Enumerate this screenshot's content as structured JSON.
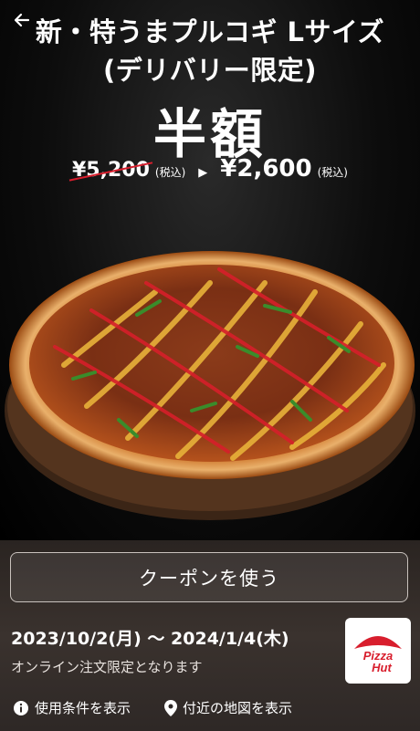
{
  "header": {
    "title_line1": "新・特うまプルコギ Lサイズ",
    "title_line2": "(デリバリー限定)",
    "back_icon": "arrow-left-icon"
  },
  "promo": {
    "headline": "半額",
    "original_price": "¥5,200",
    "original_tax": "(税込)",
    "arrow": "▶",
    "sale_price": "¥2,600",
    "sale_tax": "(税込)"
  },
  "coupon": {
    "button_label": "クーポンを使う"
  },
  "details": {
    "period": "2023/10/2(月) 〜 2024/1/4(木)",
    "note": "オンライン注文限定となります",
    "brand_logo_text": "Pizza Hut"
  },
  "links": {
    "terms_label": "使用条件を表示",
    "map_label": "付近の地図を表示"
  },
  "colors": {
    "strike": "#d81e2d",
    "logo_red": "#d81e2d",
    "background": "#000000"
  }
}
